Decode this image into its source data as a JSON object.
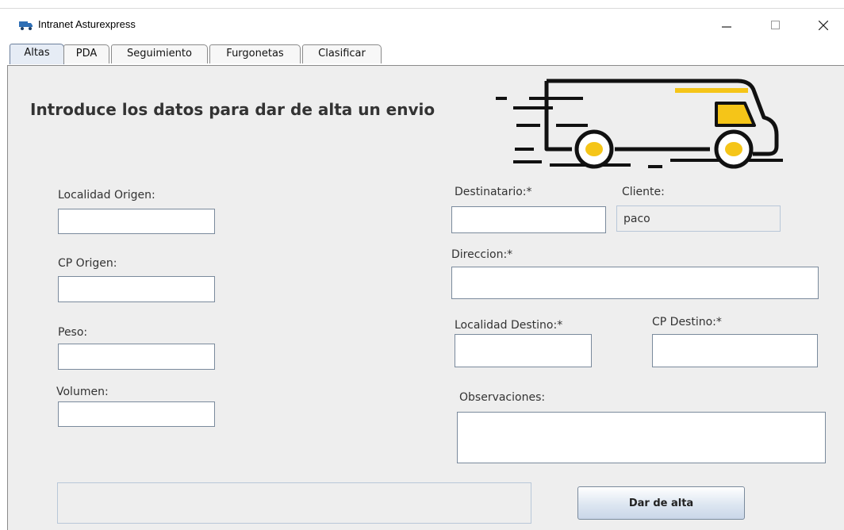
{
  "window": {
    "title": "Intranet Asturexpress",
    "icon": "truck-icon"
  },
  "tabs": [
    {
      "label": "Altas",
      "active": true
    },
    {
      "label": "PDA",
      "active": false
    },
    {
      "label": "Seguimiento",
      "active": false
    },
    {
      "label": "Furgonetas",
      "active": false
    },
    {
      "label": "Clasificar",
      "active": false
    }
  ],
  "form": {
    "heading": "Introduce los datos para dar de alta un envio",
    "localidad_origen": {
      "label": "Localidad Origen:",
      "value": ""
    },
    "cp_origen": {
      "label": "CP Origen:",
      "value": ""
    },
    "peso": {
      "label": "Peso:",
      "value": ""
    },
    "volumen": {
      "label": "Volumen:",
      "value": ""
    },
    "destinatario": {
      "label": "Destinatario:*",
      "value": ""
    },
    "cliente": {
      "label": "Cliente:",
      "value": "paco"
    },
    "direccion": {
      "label": "Direccion:*",
      "value": ""
    },
    "localidad_destino": {
      "label": "Localidad Destino:*",
      "value": ""
    },
    "cp_destino": {
      "label": "CP Destino:*",
      "value": ""
    },
    "observaciones": {
      "label": "Observaciones:",
      "value": ""
    },
    "submit_label": "Dar de alta"
  },
  "colors": {
    "accent_yellow": "#f5c518",
    "panel_bg": "#eeeeee"
  }
}
